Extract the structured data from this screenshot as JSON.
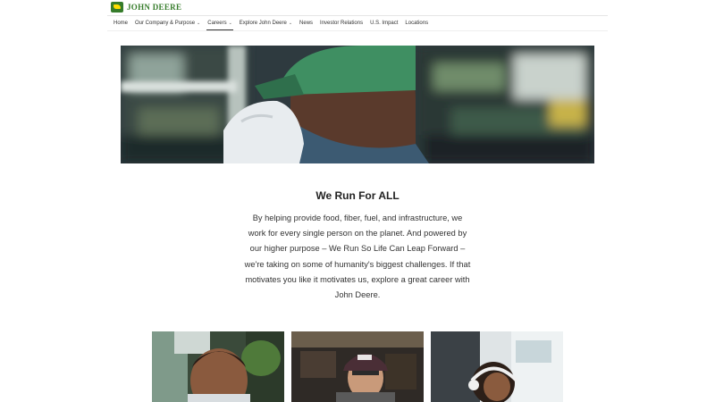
{
  "brand": {
    "name": "JOHN DEERE"
  },
  "nav": [
    {
      "label": "Home",
      "dropdown": false,
      "active": false
    },
    {
      "label": "Our Company & Purpose",
      "dropdown": true,
      "active": false
    },
    {
      "label": "Careers",
      "dropdown": true,
      "active": true
    },
    {
      "label": "Explore John Deere",
      "dropdown": true,
      "active": false
    },
    {
      "label": "News",
      "dropdown": false,
      "active": false
    },
    {
      "label": "Investor Relations",
      "dropdown": false,
      "active": false
    },
    {
      "label": "U.S. Impact",
      "dropdown": false,
      "active": false
    },
    {
      "label": "Locations",
      "dropdown": false,
      "active": false
    }
  ],
  "intro": {
    "heading": "We Run For ALL",
    "lines": [
      "By helping provide food, fiber, fuel, and infrastructure, we",
      "work for every single person on the planet. And powered by",
      "our higher purpose – We Run So Life Can Leap Forward –",
      "we're taking on some of humanity's biggest challenges. If that",
      "motivates you like it motivates us, explore a great career with",
      "John Deere."
    ]
  },
  "colors": {
    "brand_green": "#367c2b",
    "brand_yellow": "#ffde00"
  },
  "icons": {
    "dropdown": "chevron-down-icon"
  }
}
